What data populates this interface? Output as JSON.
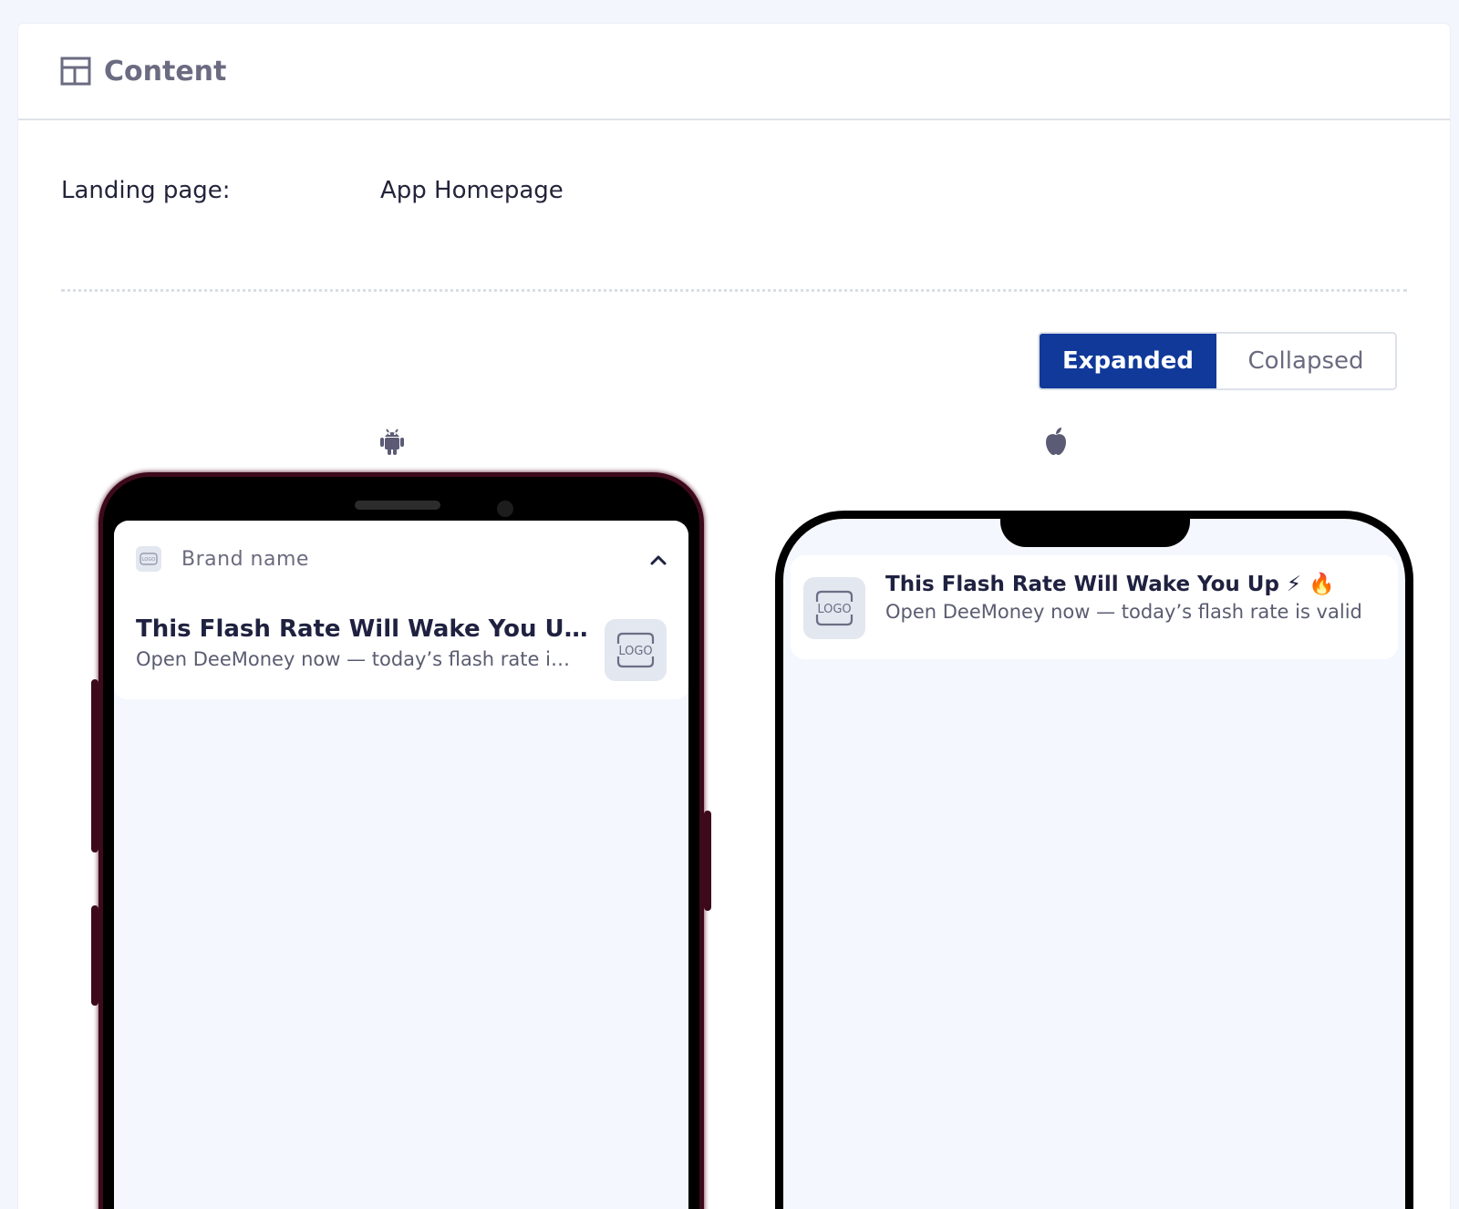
{
  "header": {
    "title": "Content",
    "icon": "layout-icon"
  },
  "landing": {
    "label": "Landing page:",
    "value": "App Homepage"
  },
  "view_toggle": {
    "options": [
      "Expanded",
      "Collapsed"
    ],
    "selected": "Expanded",
    "accent": "#10399a"
  },
  "platforms": {
    "android_icon": "android-icon",
    "ios_icon": "apple-icon"
  },
  "notification": {
    "brand_name": "Brand name",
    "title": "This Flash Rate Will Wake You Up ⚡ 🔥",
    "body": "Open DeeMoney now — today’s flash rate is valid",
    "logo_text": "LOGO"
  }
}
